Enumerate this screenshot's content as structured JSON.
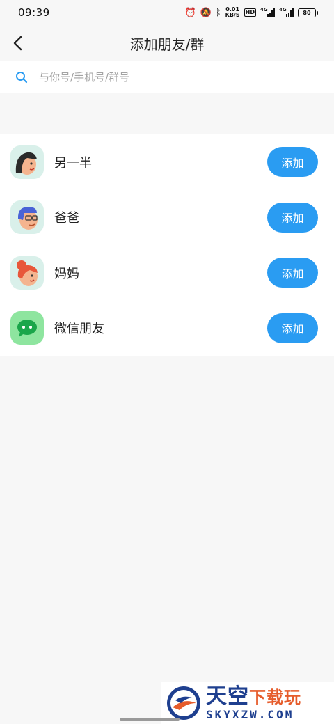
{
  "status_bar": {
    "time": "09:39",
    "net_speed_value": "0.01",
    "net_speed_unit": "KB/S",
    "hd_badge": "HD",
    "signal_1_label": "4G",
    "signal_2_label": "4G",
    "battery": "80"
  },
  "nav": {
    "title": "添加朋友/群"
  },
  "search": {
    "placeholder": "与你号/手机号/群号",
    "value": ""
  },
  "contacts": [
    {
      "label": "另一半",
      "button": "添加",
      "avatar": "woman-face-icon"
    },
    {
      "label": "爸爸",
      "button": "添加",
      "avatar": "dad-face-icon"
    },
    {
      "label": "妈妈",
      "button": "添加",
      "avatar": "mom-face-icon"
    },
    {
      "label": "微信朋友",
      "button": "添加",
      "avatar": "wechat-icon"
    }
  ],
  "watermark": {
    "main_a": "天空",
    "main_b": "下载玩",
    "sub": "SKYXZW.COM"
  },
  "colors": {
    "accent": "#2a9cf2",
    "background": "#f7f7f7",
    "avatar_bg": "#d9f0ea",
    "wechat_green": "#8ee59f"
  }
}
